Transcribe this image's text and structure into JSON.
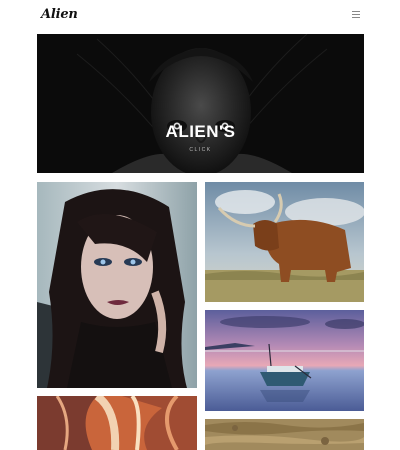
{
  "brand": {
    "logo_text": "Alien"
  },
  "header": {
    "menu_icon": "hamburger-icon"
  },
  "hero": {
    "title": "ALIEN'S",
    "subtitle": "CLICK"
  },
  "gallery": {
    "items": [
      {
        "subject": "woman-portrait"
      },
      {
        "subject": "highland-cattle"
      },
      {
        "subject": "boat-at-sunset"
      },
      {
        "subject": "canyon-rock"
      },
      {
        "subject": "sand-texture"
      }
    ]
  }
}
